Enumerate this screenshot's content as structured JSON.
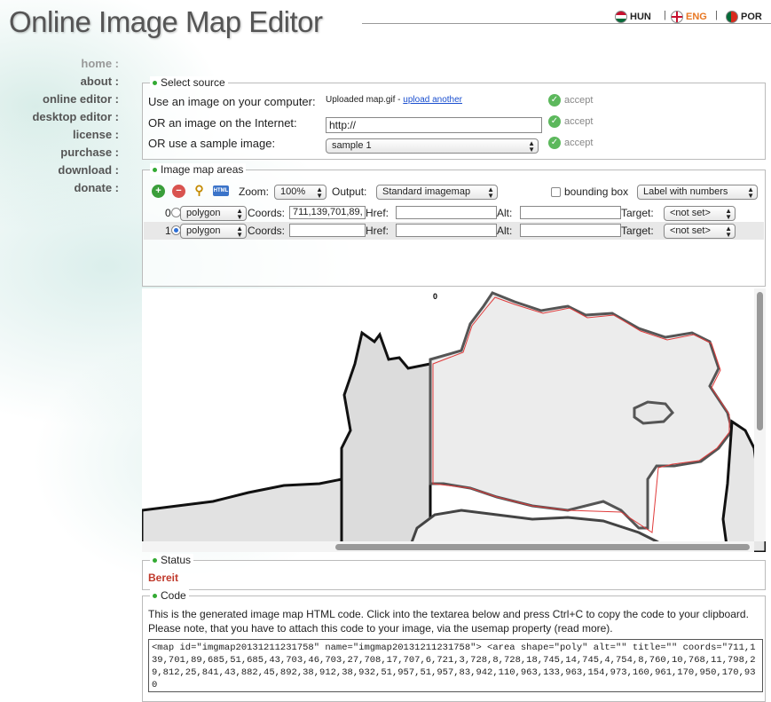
{
  "app": {
    "title": "Online Image Map Editor"
  },
  "languages": [
    {
      "code": "HUN",
      "active": false,
      "color": "#c8102e"
    },
    {
      "code": "ENG",
      "active": true,
      "color": "#e87722"
    },
    {
      "code": "POR",
      "active": false,
      "color": "#046a38"
    }
  ],
  "nav": {
    "items": [
      "home :",
      "about :",
      "online editor :",
      "desktop editor :",
      "license :",
      "purchase :",
      "download :",
      "donate :"
    ]
  },
  "source": {
    "legend": "Select source",
    "row1_label": "Use an image on your computer:",
    "row1_value": "Uploaded map.gif - ",
    "row1_link": "upload another",
    "row2_label": "OR an image on the Internet:",
    "row2_value": "http://",
    "row3_label": "OR use a sample image:",
    "row3_value": "sample 1",
    "accept": "accept"
  },
  "areas": {
    "legend": "Image map areas",
    "zoom_label": "Zoom:",
    "zoom_value": "100%",
    "output_label": "Output:",
    "output_value": "Standard imagemap",
    "bbox_label": "bounding box",
    "label_mode": "Label with numbers",
    "coords_label": "Coords:",
    "href_label": "Href:",
    "alt_label": "Alt:",
    "target_label": "Target:",
    "rows": [
      {
        "index": "0",
        "shape": "polygon",
        "coords": "711,139,701,89,",
        "href": "",
        "alt": "",
        "target": "<not set>",
        "selected": false
      },
      {
        "index": "1",
        "shape": "polygon",
        "coords": "",
        "href": "",
        "alt": "",
        "target": "<not set>",
        "selected": true
      }
    ]
  },
  "canvas": {
    "area_label": "0"
  },
  "status": {
    "legend": "Status",
    "text": "Bereit"
  },
  "code": {
    "legend": "Code",
    "description": "This is the generated image map HTML code. Click into the textarea below and press Ctrl+C to copy the code to your clipboard. Please note, that you have to attach this code to your image, via the usemap property (read more).",
    "html": "<map id=\"imgmap20131211231758\" name=\"imgmap20131211231758\"> <area shape=\"poly\" alt=\"\" title=\"\" coords=\"711,139,701,89,685,51,685,43,703,46,703,27,708,17,707,6,721,3,728,8,728,18,745,14,745,4,754,8,760,10,768,11,798,29,812,25,841,43,882,45,892,38,912,38,932,51,957,51,957,83,942,110,963,133,963,154,973,160,961,170,950,170,930"
  },
  "colors": {
    "accent": "#3a3",
    "status": "#c0392b",
    "link": "#1a4fcf"
  }
}
